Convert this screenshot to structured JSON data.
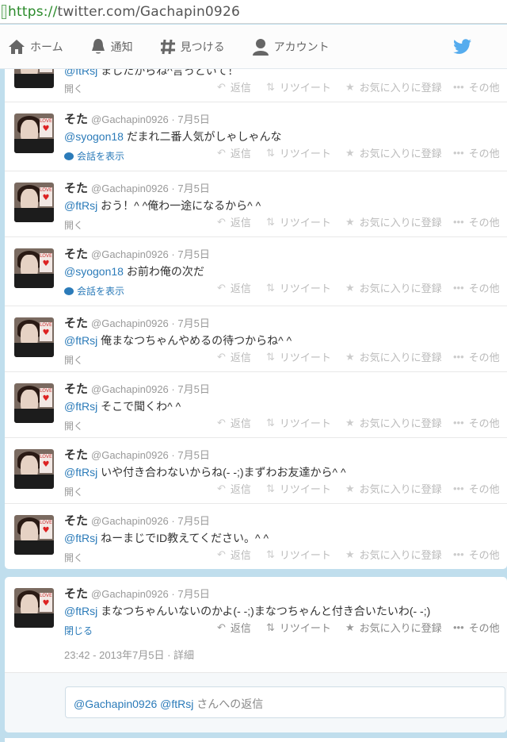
{
  "browser": {
    "url_scheme": "https://",
    "url_rest": "twitter.com/Gachapin0926"
  },
  "nav": {
    "home": "ホーム",
    "notify": "通知",
    "discover": "見つける",
    "account": "アカウント"
  },
  "colors": {
    "accent": "#2b7bb9",
    "background": "#c0deed",
    "bird": "#55acee"
  },
  "actions": {
    "reply": "返信",
    "retweet": "リツイート",
    "favorite": "お気に入りに登録",
    "more": "その他"
  },
  "tweets": [
    {
      "name": "",
      "handle": "",
      "date": "",
      "mention": "@ftRsj",
      "text": " ましたからね^言っといて！",
      "link": "開く"
    },
    {
      "name": "そた",
      "handle": "@Gachapin0926",
      "date": "· 7月5日",
      "mention": "@syogon18",
      "text": " だまれ二番人気がしゃしゃんな",
      "link": "会話を表示"
    },
    {
      "name": "そた",
      "handle": "@Gachapin0926",
      "date": "· 7月5日",
      "mention": "@ftRsj",
      "text": " おう！^ ^俺わ一途になるから^ ^",
      "link": "開く"
    },
    {
      "name": "そた",
      "handle": "@Gachapin0926",
      "date": "· 7月5日",
      "mention": "@syogon18",
      "text": " お前わ俺の次だ",
      "link": "会話を表示"
    },
    {
      "name": "そた",
      "handle": "@Gachapin0926",
      "date": "· 7月5日",
      "mention": "@ftRsj",
      "text": " 俺まなつちゃんやめるの待つからね^ ^",
      "link": "開く"
    },
    {
      "name": "そた",
      "handle": "@Gachapin0926",
      "date": "· 7月5日",
      "mention": "@ftRsj",
      "text": " そこで聞くわ^ ^",
      "link": "開く"
    },
    {
      "name": "そた",
      "handle": "@Gachapin0926",
      "date": "· 7月5日",
      "mention": "@ftRsj",
      "text": " いや付き合わないからね(- -;)まずわお友達から^ ^",
      "link": "開く"
    },
    {
      "name": "そた",
      "handle": "@Gachapin0926",
      "date": "· 7月5日",
      "mention": "@ftRsj",
      "text": " ねーまじでID教えてください。^ ^",
      "link": "開く"
    }
  ],
  "expanded": {
    "name": "そた",
    "handle": "@Gachapin0926",
    "date": "· 7月5日",
    "mention": "@ftRsj",
    "text": " まなつちゃんいないのかよ(- -;)まなつちゃんと付き合いたいわ(- -;)",
    "link": "閉じる",
    "timestamp": "23:42 - 2013年7月5日",
    "detail": "· 詳細",
    "reply_prefix": "@Gachapin0926 @ftRsj",
    "reply_suffix": " さんへの返信"
  },
  "avatar_badge": "LOVE"
}
